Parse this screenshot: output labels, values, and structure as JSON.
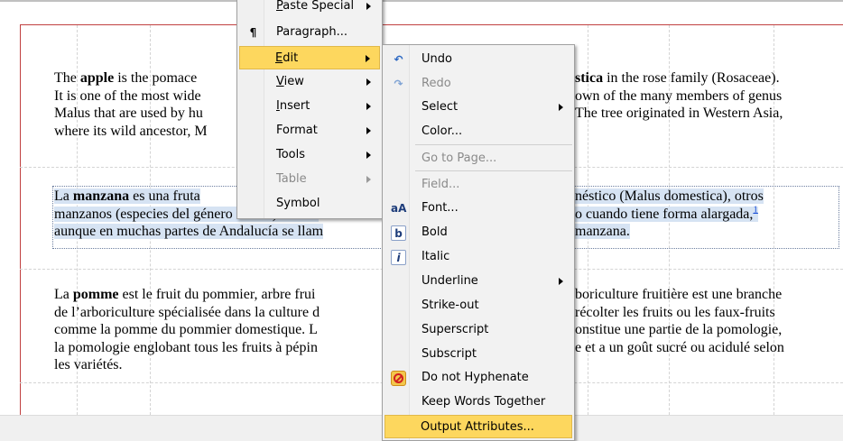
{
  "document": {
    "paragraph_en": {
      "before": "The ",
      "bold": "apple",
      "after": " is the pomaceous fruit of the apple tree, Malus domestica in the rose family (Rosaceae). It is one of the most widely cultivated tree fruits, and the most widely known of the many members of genus Malus that are used by humans. The tree originated in Western Asia, where its wild ancestor, Malus sieversii, is still found today.",
      "visible_left": [
        "The ",
        "apple",
        " is the pomace",
        "It is one of the most wide",
        "Malus that are used by hu",
        "where its wild ancestor, M"
      ],
      "visible_right": [
        "stica",
        " in the rose family (Rosaceae).",
        "own of the many members of genus",
        "The tree originated in Western Asia,"
      ]
    },
    "paragraph_es": {
      "line1_left": "La ",
      "bold": "manzana",
      "line1_mid": " es una fruta",
      "line1_right": "néstico (Malus domestica), otros",
      "line2_left": "manzanos (especies del género Malus) o híbri",
      "line2_right": "o cuando tiene forma alargada,",
      "footnote": "1",
      "line3_left": "aunque en muchas partes de Andalucía se llam",
      "line3_right": "manzana."
    },
    "paragraph_fr": {
      "line1_left": "La ",
      "bold": "pomme",
      "line1_mid": " est le fruit du pommier, arbre frui",
      "line1_right": "boriculture fruitière est une branche",
      "line2_left": "de l’arboriculture spécialisée dans la culture d",
      "line2_right": "récolter les fruits ou les faux-fruits",
      "line3_left": "comme la pomme du pommier domestique. L",
      "line3_right": "onstitue une partie de la pomologie,",
      "line4_left": "la pomologie englobant tous les fruits à pépin",
      "line4_right": "e et a un goût sucré ou acidulé selon",
      "line5_left": "les variétés."
    }
  },
  "context_menu": {
    "items": [
      {
        "label": "Paste Special",
        "accel": "P",
        "rest": "aste Special",
        "icon": "",
        "submenu": true
      },
      {
        "label": "Paragraph...",
        "accel": "",
        "icon": "pilcrow-icon",
        "submenu": false
      },
      {
        "label": "Edit",
        "accel": "E",
        "rest": "dit",
        "icon": "",
        "submenu": true,
        "highlighted": true
      },
      {
        "label": "View",
        "accel": "V",
        "rest": "iew",
        "icon": "",
        "submenu": true
      },
      {
        "label": "Insert",
        "accel": "I",
        "rest": "nsert",
        "icon": "",
        "submenu": true
      },
      {
        "label": "Format",
        "icon": "",
        "submenu": true
      },
      {
        "label": "Tools",
        "icon": "",
        "submenu": true
      },
      {
        "label": "Table",
        "icon": "",
        "submenu": true,
        "disabled": true
      },
      {
        "label": "Symbol",
        "icon": "",
        "submenu": false
      }
    ]
  },
  "edit_submenu": {
    "items": [
      {
        "label": "Undo",
        "icon": "undo-icon"
      },
      {
        "label": "Redo",
        "icon": "redo-icon",
        "disabled": true
      },
      {
        "label": "Select",
        "submenu": true
      },
      {
        "label": "Color..."
      },
      {
        "label": "Go to Page...",
        "disabled": true
      },
      {
        "label": "Field...",
        "disabled": true
      },
      {
        "label": "Font...",
        "icon": "font-icon"
      },
      {
        "label": "Bold",
        "icon": "bold-icon"
      },
      {
        "label": "Italic",
        "icon": "italic-icon"
      },
      {
        "label": "Underline",
        "submenu": true
      },
      {
        "label": "Strike-out"
      },
      {
        "label": "Superscript"
      },
      {
        "label": "Subscript"
      },
      {
        "label": "Do not Hyphenate",
        "icon": "no-hyphenate-icon"
      },
      {
        "label": "Keep Words Together"
      },
      {
        "label": "Output Attributes...",
        "highlighted": true
      }
    ]
  },
  "colors": {
    "menu_highlight": "#fdd75e",
    "selection": "#d6e3f3",
    "margin_line": "#c04040",
    "footnote_link": "#1a4fd8"
  }
}
